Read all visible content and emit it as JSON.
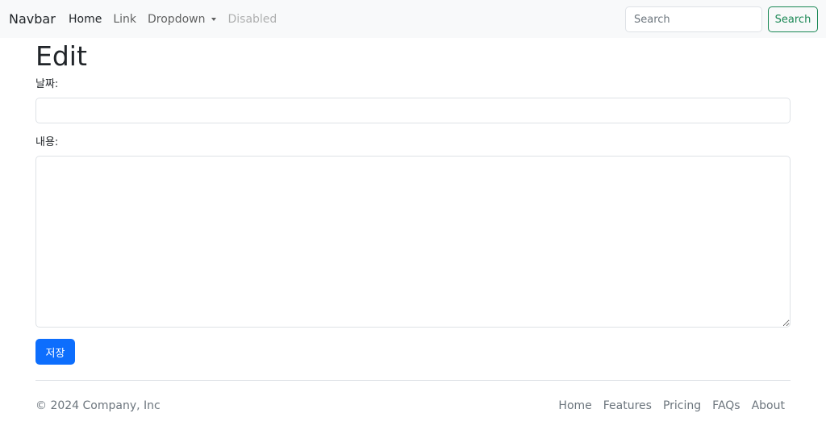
{
  "navbar": {
    "brand": "Navbar",
    "links": [
      {
        "label": "Home",
        "state": "active"
      },
      {
        "label": "Link",
        "state": "normal"
      },
      {
        "label": "Dropdown",
        "state": "dropdown"
      },
      {
        "label": "Disabled",
        "state": "disabled"
      }
    ],
    "search": {
      "placeholder": "Search",
      "value": "",
      "button_label": "Search"
    }
  },
  "main": {
    "title": "Edit",
    "date_label": "날짜:",
    "date_value": "",
    "content_label": "내용:",
    "content_value": "",
    "save_label": "저장"
  },
  "footer": {
    "copyright": "© 2024 Company, Inc",
    "links": [
      "Home",
      "Features",
      "Pricing",
      "FAQs",
      "About"
    ]
  },
  "colors": {
    "navbar_bg": "#f8f9fa",
    "primary": "#0d6efd",
    "success": "#198754",
    "muted": "#6c757d",
    "border": "#dee2e6"
  }
}
